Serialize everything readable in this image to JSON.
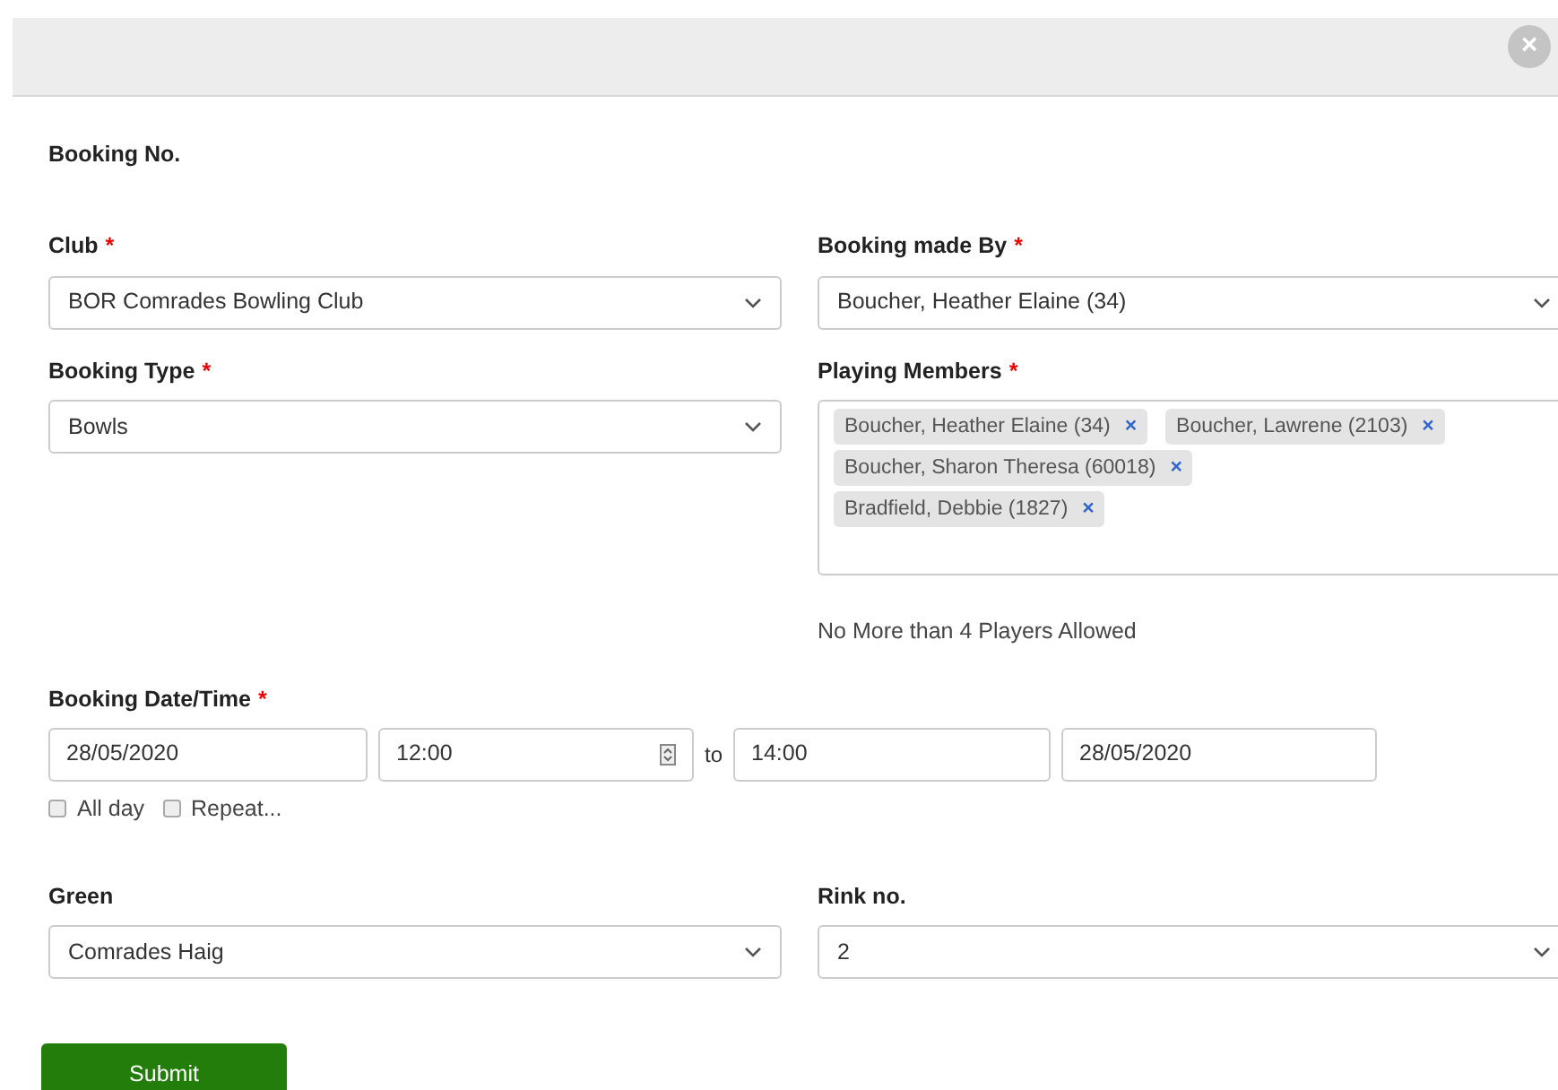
{
  "header": {
    "close": "×"
  },
  "booking_no": {
    "label": "Booking No."
  },
  "fields": [
    {
      "kind": "select",
      "label": "Club",
      "required_mark": "*",
      "value": "BOR Comrades Bowling Club"
    },
    {
      "kind": "select",
      "label": "Booking made By",
      "required_mark": "*",
      "value": "Boucher, Heather Elaine (34)"
    },
    {
      "kind": "select",
      "label": "Booking Type",
      "required_mark": "*",
      "value": "Bowls"
    },
    {
      "kind": "tags",
      "label": "Playing Members",
      "required_mark": "*",
      "tags": [
        "Boucher, Heather Elaine (34)",
        "Boucher, Lawrene (2103)",
        "Boucher, Sharon Theresa (60018)",
        "Bradfield, Debbie (1827)"
      ],
      "remove": "×",
      "note": "No More than 4 Players Allowed"
    }
  ],
  "datetime": {
    "label": "Booking Date/Time",
    "required_mark": "*",
    "start_date": "28/05/2020",
    "start_time": "12:00",
    "separator": "to",
    "end_time": "14:00",
    "end_date": "28/05/2020",
    "options": [
      {
        "label": "All day",
        "checked": false
      },
      {
        "label": "Repeat...",
        "checked": false
      }
    ]
  },
  "bottom_fields": [
    {
      "kind": "select",
      "label": "Green",
      "value": "Comrades Haig"
    },
    {
      "kind": "select",
      "label": "Rink no.",
      "value": "2"
    }
  ],
  "submit": "Submit"
}
